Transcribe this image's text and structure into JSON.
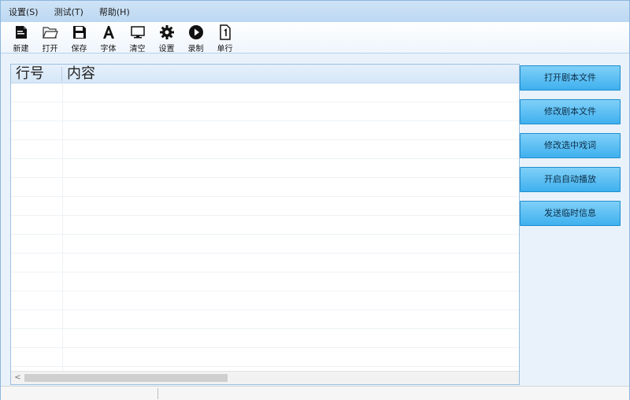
{
  "menu": {
    "items": [
      {
        "label": "设置(S)"
      },
      {
        "label": "测试(T)"
      },
      {
        "label": "帮助(H)"
      }
    ]
  },
  "toolbar": {
    "items": [
      {
        "label": "新建",
        "icon": "new-file-icon"
      },
      {
        "label": "打开",
        "icon": "folder-open-icon"
      },
      {
        "label": "保存",
        "icon": "save-icon"
      },
      {
        "label": "字体",
        "icon": "font-icon"
      },
      {
        "label": "清空",
        "icon": "monitor-clear-icon"
      },
      {
        "label": "设置",
        "icon": "gear-icon"
      },
      {
        "label": "录制",
        "icon": "record-play-icon"
      },
      {
        "label": "单行",
        "icon": "single-line-icon"
      }
    ]
  },
  "grid": {
    "columns": [
      "行号",
      "内容"
    ],
    "rows": []
  },
  "side_buttons": [
    {
      "label": "打开剧本文件"
    },
    {
      "label": "修改剧本文件"
    },
    {
      "label": "修改选中戏词"
    },
    {
      "label": "开启自动播放"
    },
    {
      "label": "发送临时信息"
    }
  ],
  "status": {
    "left": "",
    "right": ""
  },
  "colors": {
    "accent_button": "#3fb0ee",
    "menubar": "#bcd8f2",
    "window_bg": "#e9f2fb"
  }
}
